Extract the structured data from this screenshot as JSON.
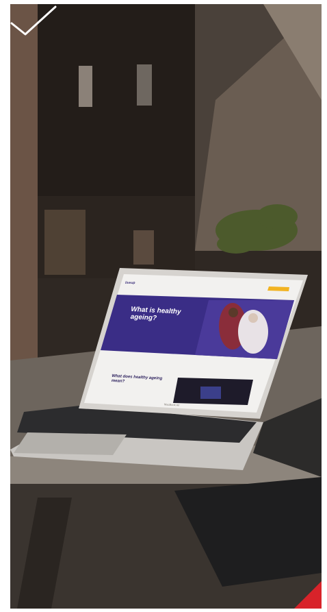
{
  "overlay": {
    "check_icon": "checkmark-icon",
    "accent_color": "#d8232a"
  },
  "laptop": {
    "logo_text": "liveup",
    "hero_title": "What is healthy ageing?",
    "section_heading": "What does healthy ageing mean?",
    "cta_label": "",
    "model_text": "MacBook Air"
  }
}
